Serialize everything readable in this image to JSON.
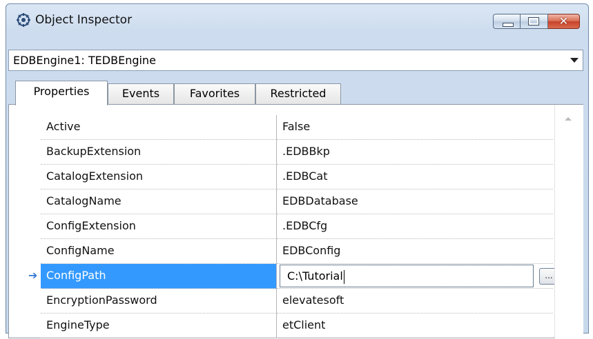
{
  "window": {
    "title": "Object Inspector",
    "icons": {
      "app": "object-inspector-icon",
      "minimize": "minimize-icon",
      "maximize": "maximize-icon",
      "close": "close-icon"
    },
    "close_glyph": "✕"
  },
  "object_selector": {
    "value": "EDBEngine1: TEDBEngine"
  },
  "tabs": [
    {
      "label": "Properties",
      "active": true
    },
    {
      "label": "Events",
      "active": false
    },
    {
      "label": "Favorites",
      "active": false
    },
    {
      "label": "Restricted",
      "active": false
    }
  ],
  "properties": [
    {
      "name": "Active",
      "value": "False"
    },
    {
      "name": "BackupExtension",
      "value": ".EDBBkp"
    },
    {
      "name": "CatalogExtension",
      "value": ".EDBCat"
    },
    {
      "name": "CatalogName",
      "value": "EDBDatabase"
    },
    {
      "name": "ConfigExtension",
      "value": ".EDBCfg"
    },
    {
      "name": "ConfigName",
      "value": "EDBConfig"
    },
    {
      "name": "ConfigPath",
      "value": "C:\\Tutorial"
    },
    {
      "name": "EncryptionPassword",
      "value": "elevatesoft"
    },
    {
      "name": "EngineType",
      "value": "etClient"
    }
  ],
  "editor": {
    "ellipsis_label": "...",
    "row_marker": "➔"
  },
  "colors": {
    "selection": "#3399ff",
    "title_gradient_top": "#dbe7f5",
    "close_button": "#c7432a"
  }
}
